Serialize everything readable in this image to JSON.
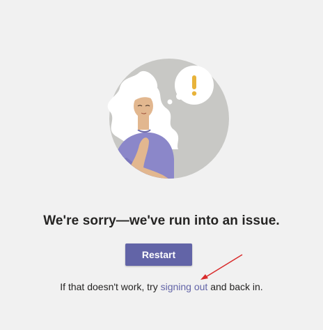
{
  "colors": {
    "background": "#f1f1f1",
    "circle": "#c8c8c5",
    "accent": "#6264a7",
    "exclamation": "#e8b33a",
    "annotation_arrow": "#d92b2b"
  },
  "illustration": {
    "icon": "person-thinking-illustration",
    "bubble_icon": "exclamation-icon"
  },
  "error": {
    "headline": "We're sorry—we've run into an issue."
  },
  "actions": {
    "restart_label": "Restart"
  },
  "help": {
    "prefix": "If that doesn't work, try ",
    "link_label": "signing out",
    "suffix": " and back in."
  }
}
